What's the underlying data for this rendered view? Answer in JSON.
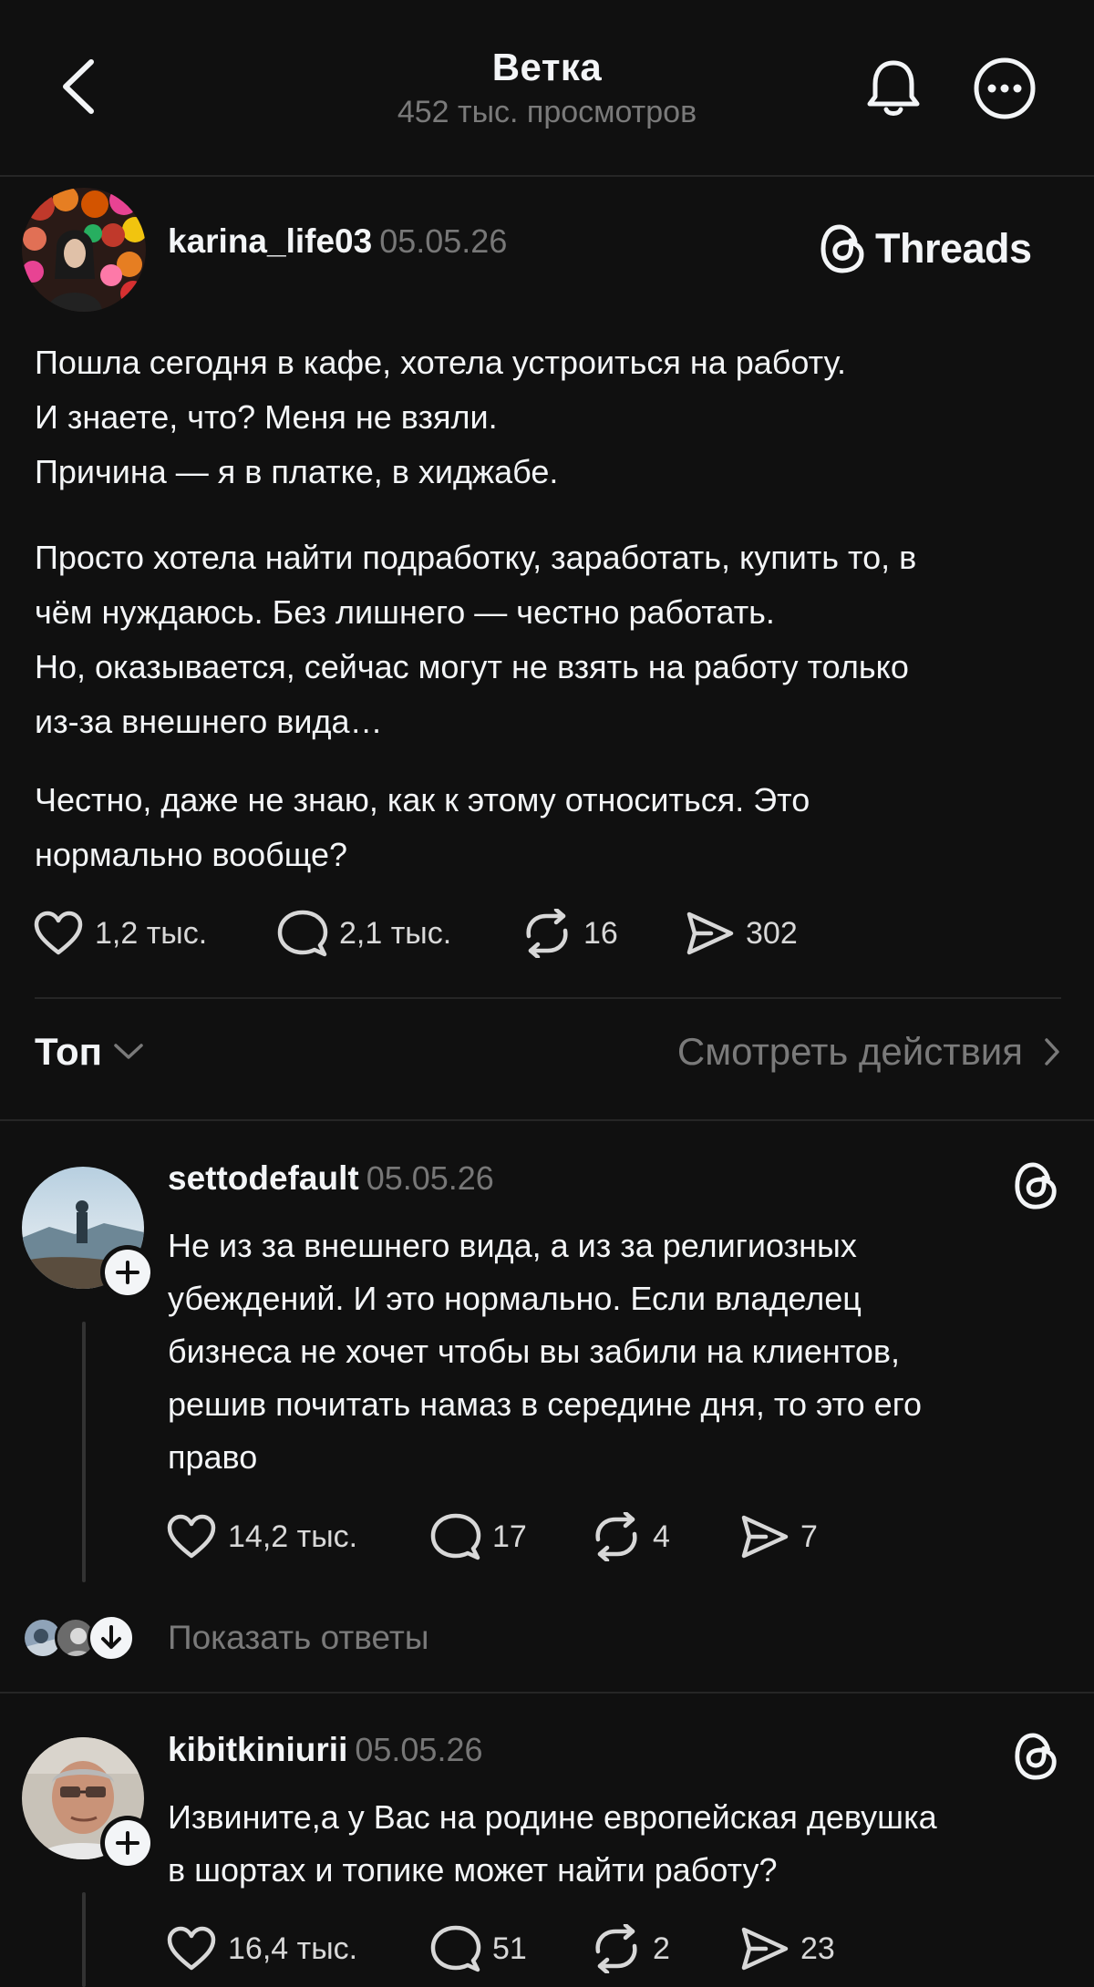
{
  "header": {
    "title": "Ветка",
    "views": "452 тыс. просмотров"
  },
  "post": {
    "username": "karina_life03",
    "date": "05.05.26",
    "brand": "Threads",
    "lines": [
      "Пошла сегодня в кафе, хотела устроиться на работу.",
      "И знаете, что? Меня не взяли.",
      "Причина — я в платке, в хиджабе.",
      "Просто хотела найти подработку, заработать, купить то, в",
      "чём нуждаюсь. Без лишнего — честно работать.",
      "Но, оказывается, сейчас могут не взять на работу только",
      "из-за внешнего вида…",
      "Честно, даже не знаю, как к этому относиться. Это",
      "нормально вообще?"
    ],
    "likes": "1,2 тыс.",
    "comments": "2,1 тыс.",
    "reposts": "16",
    "shares": "302"
  },
  "sort": {
    "label": "Топ",
    "activity_label": "Смотреть действия"
  },
  "replies": [
    {
      "username": "settodefault",
      "date": "05.05.26",
      "lines": [
        "Не из за внешнего вида, а из за религиозных",
        "убеждений. И это нормально. Если владелец",
        "бизнеса не хочет чтобы вы забили на клиентов,",
        "решив почитать намаз в середине дня, то это его",
        "право"
      ],
      "likes": "14,2 тыс.",
      "comments": "17",
      "reposts": "4",
      "shares": "7",
      "show_replies": "Показать ответы"
    },
    {
      "username": "kibitkiniurii",
      "date": "05.05.26",
      "lines": [
        "Извините,а у Вас на родине европейская девушка",
        "в шортах и топике может найти работу?"
      ],
      "likes": "16,4 тыс.",
      "comments": "51",
      "reposts": "2",
      "shares": "23"
    }
  ],
  "colors": {
    "background": "#101010",
    "text": "#f3f5f7",
    "muted": "#7a7a7a",
    "divider": "#262626"
  },
  "icons": {
    "back": "chevron-left-icon",
    "notifications": "bell-icon",
    "more": "more-horizontal-icon",
    "like": "heart-icon",
    "comment": "speech-bubble-icon",
    "repost": "repost-icon",
    "share": "send-icon",
    "threads": "threads-logo-icon",
    "follow": "plus-icon",
    "expand": "arrow-down-icon"
  }
}
